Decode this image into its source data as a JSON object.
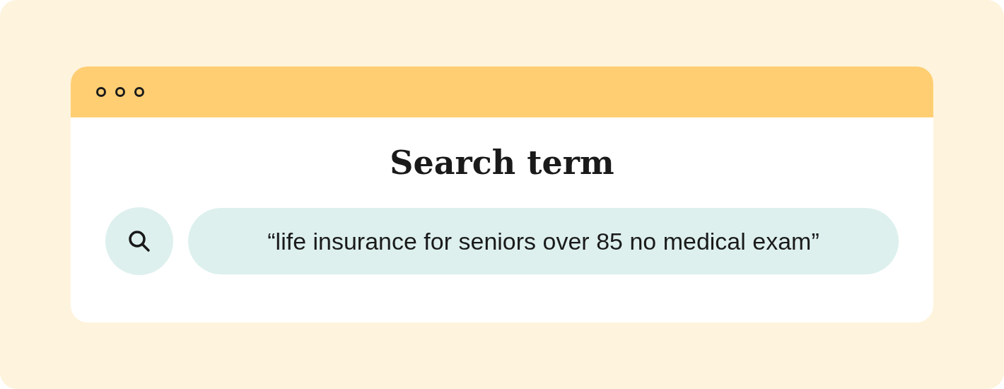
{
  "heading": "Search term",
  "search": {
    "value": "“life insurance for seniors over 85 no medical exam”"
  }
}
